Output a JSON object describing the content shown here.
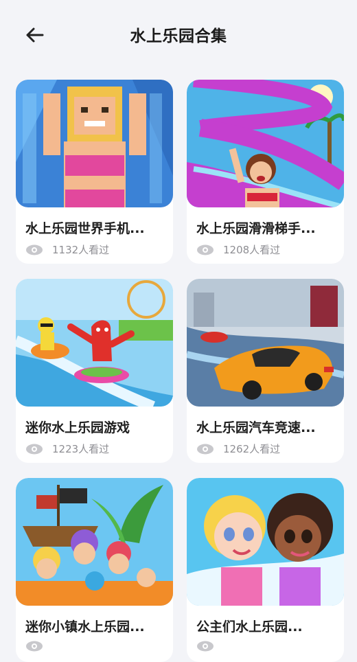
{
  "header": {
    "title": "水上乐园合集",
    "back_icon": "arrow-left-icon"
  },
  "games": [
    {
      "title": "水上乐园世界手机...",
      "views": "1132人看过",
      "thumb": "pixel-girl-waterslide"
    },
    {
      "title": "水上乐园滑滑梯手...",
      "views": "1208人看过",
      "thumb": "girl-purple-slide"
    },
    {
      "title": "迷你水上乐园游戏",
      "views": "1223人看过",
      "thumb": "jelly-figure-slide"
    },
    {
      "title": "水上乐园汽车竞速...",
      "views": "1262人看过",
      "thumb": "orange-car-water"
    },
    {
      "title": "迷你小镇水上乐园...",
      "views": "",
      "thumb": "kids-pirate-ship"
    },
    {
      "title": "公主们水上乐园...",
      "views": "",
      "thumb": "two-princess-girls"
    }
  ],
  "colors": {
    "background": "#f3f4f8",
    "card": "#ffffff",
    "muted_text": "#8e8e93"
  },
  "icons": {
    "views": "eye-icon"
  }
}
